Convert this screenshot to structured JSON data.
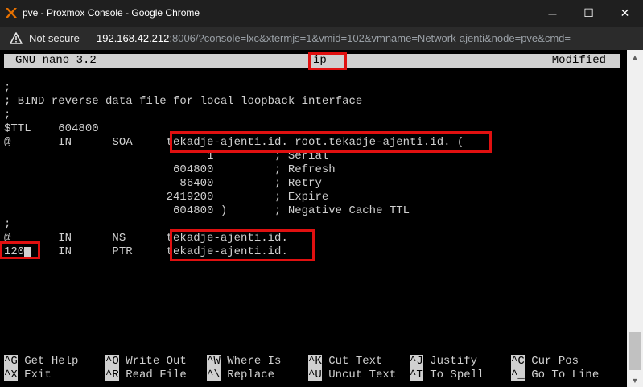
{
  "window": {
    "title": "pve - Proxmox Console - Google Chrome",
    "minimize_glyph": "─",
    "maximize_glyph": "☐",
    "close_glyph": "✕"
  },
  "addressbar": {
    "security_label": "Not secure",
    "host": "192.168.42.212",
    "path": ":8006/?console=lxc&xtermjs=1&vmid=102&vmname=Network-ajenti&node=pve&cmd="
  },
  "nano": {
    "version": "GNU nano 3.2",
    "filename": "ip",
    "status": "Modified"
  },
  "file_lines": [
    ";",
    "; BIND reverse data file for local loopback interface",
    ";",
    "$TTL    604800",
    "@       IN      SOA     tekadje-ajenti.id. root.tekadje-ajenti.id. (",
    "                              1         ; Serial",
    "                         604800         ; Refresh",
    "                          86400         ; Retry",
    "                        2419200         ; Expire",
    "                         604800 )       ; Negative Cache TTL",
    ";",
    "@       IN      NS      tekadje-ajenti.id.",
    "120     IN      PTR     tekadje-ajenti.id."
  ],
  "shortcuts_row1": [
    {
      "key": "^G",
      "label": "Get Help"
    },
    {
      "key": "^O",
      "label": "Write Out"
    },
    {
      "key": "^W",
      "label": "Where Is"
    },
    {
      "key": "^K",
      "label": "Cut Text"
    },
    {
      "key": "^J",
      "label": "Justify"
    },
    {
      "key": "^C",
      "label": "Cur Pos"
    }
  ],
  "shortcuts_row2": [
    {
      "key": "^X",
      "label": "Exit"
    },
    {
      "key": "^R",
      "label": "Read File"
    },
    {
      "key": "^\\",
      "label": "Replace"
    },
    {
      "key": "^U",
      "label": "Uncut Text"
    },
    {
      "key": "^T",
      "label": "To Spell"
    },
    {
      "key": "^_",
      "label": "Go To Line"
    }
  ],
  "colors": {
    "annotation": "#e01010",
    "terminal_fg": "#d0d0d0",
    "terminal_bg": "#000000"
  }
}
